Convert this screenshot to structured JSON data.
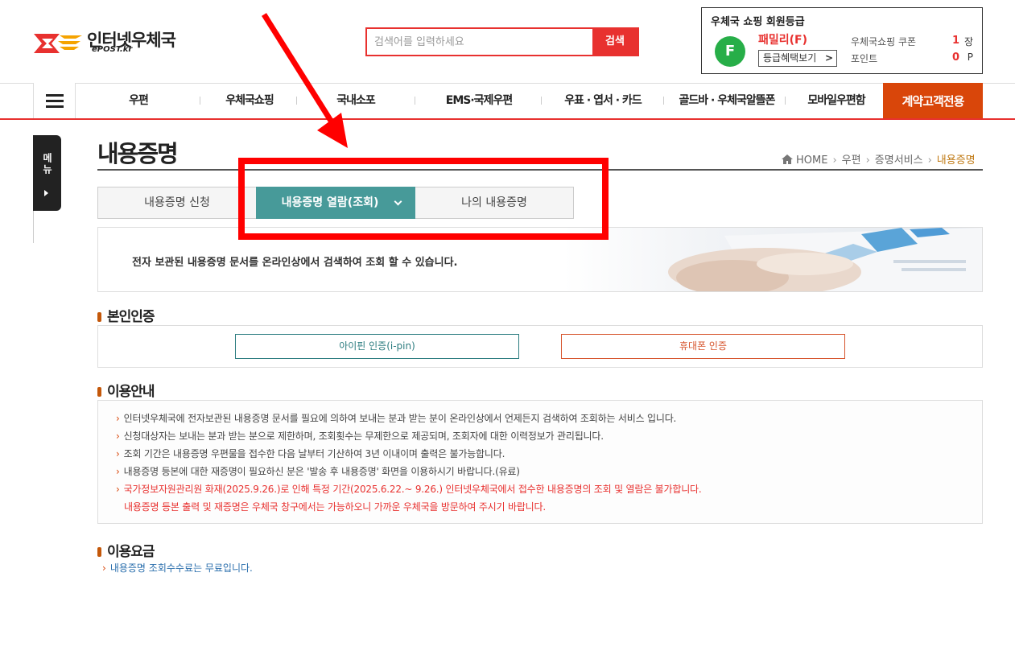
{
  "header": {
    "logo_text": "인터넷우체국",
    "logo_sub": "ePOST.kr",
    "search_placeholder": "검색어를 입력하세요",
    "search_button": "검색"
  },
  "member": {
    "title": "우체국 쇼핑 회원등급",
    "grade_letter": "F",
    "grade_name": "패밀리(F)",
    "benefit_button": "등급혜택보기",
    "coupon_label": "우체국쇼핑 쿠폰",
    "coupon_value": "1",
    "coupon_unit": "장",
    "point_label": "포인트",
    "point_value": "0",
    "point_unit": "P"
  },
  "nav": {
    "items": [
      "우편",
      "우체국쇼핑",
      "국내소포",
      "EMS·국제우편",
      "우표 · 엽서 · 카드",
      "골드바 · 우체국알뜰폰",
      "모바일우편함"
    ],
    "contract": "계약고객전용"
  },
  "side_menu": "메뉴",
  "page": {
    "title": "내용증명",
    "breadcrumb": [
      "HOME",
      "우편",
      "증명서비스",
      "내용증명"
    ]
  },
  "tabs": [
    "내용증명 신청",
    "내용증명 열람(조회)",
    "나의 내용증명"
  ],
  "banner_text": "전자 보관된 내용증명 문서를 온라인상에서 검색하여 조회 할 수 있습니다.",
  "auth": {
    "title": "본인인증",
    "ipin": "아이핀 인증(i-pin)",
    "phone": "휴대폰 인증"
  },
  "guide": {
    "title": "이용안내",
    "lines": [
      "인터넷우체국에 전자보관된 내용증명 문서를 필요에 의하여 보내는 분과 받는 분이 온라인상에서 언제든지 검색하여 조회하는 서비스 입니다.",
      "신청대상자는 보내는 분과 받는 분으로 제한하며, 조회횟수는 무제한으로 제공되며, 조회자에 대한 이력정보가 관리됩니다.",
      "조회 기간은 내용증명 우편물을 접수한 다음 날부터 기산하여 3년 이내이며 출력은 불가능합니다.",
      "내용증명 등본에 대한 재증명이 필요하신 분은 '발송 후 내용증명' 화면을 이용하시기 바랍니다.(유료)"
    ],
    "notice_line1": "국가정보자원관리원 화재(2025.9.26.)로 인해 특정 기간(2025.6.22.~ 9.26.) 인터넷우체국에서 접수한 내용증명의 조회 및 열람은 불가합니다.",
    "notice_line2": "내용증명 등본 출력 및 재증명은 우체국 창구에서는 가능하오니 가까운 우체국을 방문하여 주시기 바랍니다."
  },
  "fee": {
    "title": "이용요금",
    "text": "내용증명 조회수수료는 무료입니다."
  }
}
